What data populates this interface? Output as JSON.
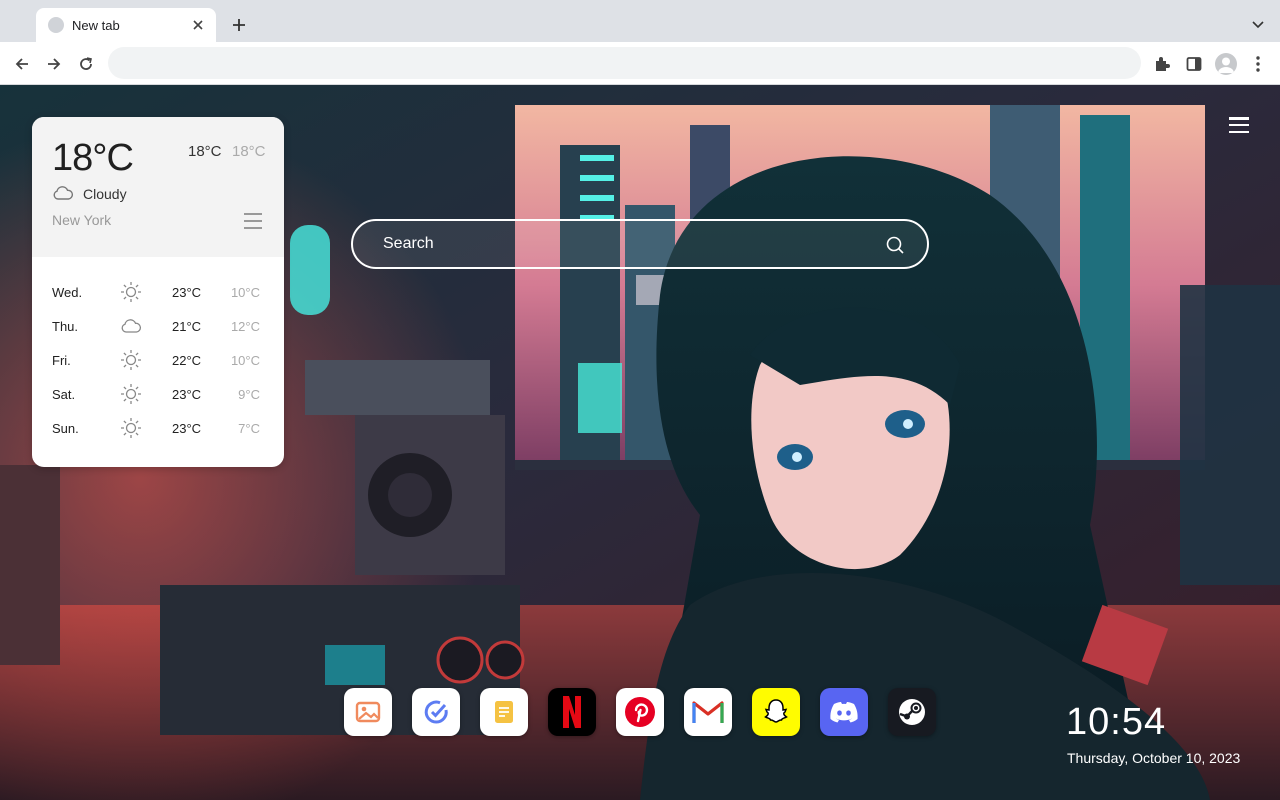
{
  "browser": {
    "tab_title": "New tab",
    "address_value": "",
    "address_placeholder": ""
  },
  "weather": {
    "current_temp": "18°C",
    "high": "18°C",
    "low": "18°C",
    "condition": "Cloudy",
    "city": "New York",
    "forecast": [
      {
        "day": "Wed.",
        "icon": "sun-icon",
        "high": "23°C",
        "low": "10°C"
      },
      {
        "day": "Thu.",
        "icon": "cloud-icon",
        "high": "21°C",
        "low": "12°C"
      },
      {
        "day": "Fri.",
        "icon": "sun-icon",
        "high": "22°C",
        "low": "10°C"
      },
      {
        "day": "Sat.",
        "icon": "sun-icon",
        "high": "23°C",
        "low": "9°C"
      },
      {
        "day": "Sun.",
        "icon": "sun-icon",
        "high": "23°C",
        "low": "7°C"
      }
    ]
  },
  "search": {
    "placeholder": "Search"
  },
  "dock": {
    "apps": [
      {
        "name": "photos",
        "icon": "photos-icon"
      },
      {
        "name": "tasks",
        "icon": "check-icon"
      },
      {
        "name": "notes",
        "icon": "notes-icon"
      },
      {
        "name": "netflix",
        "icon": "netflix-icon"
      },
      {
        "name": "pinterest",
        "icon": "pinterest-icon"
      },
      {
        "name": "gmail",
        "icon": "gmail-icon"
      },
      {
        "name": "snapchat",
        "icon": "snapchat-icon"
      },
      {
        "name": "discord",
        "icon": "discord-icon"
      },
      {
        "name": "steam",
        "icon": "steam-icon"
      }
    ]
  },
  "clock": {
    "time": "10:54",
    "date": "Thursday, October 10, 2023"
  },
  "colors": {
    "accent_netflix": "#e50914",
    "accent_pinterest": "#e60023",
    "accent_snapchat": "#fffc00",
    "accent_discord": "#5865f2",
    "accent_steam": "#171a21"
  }
}
